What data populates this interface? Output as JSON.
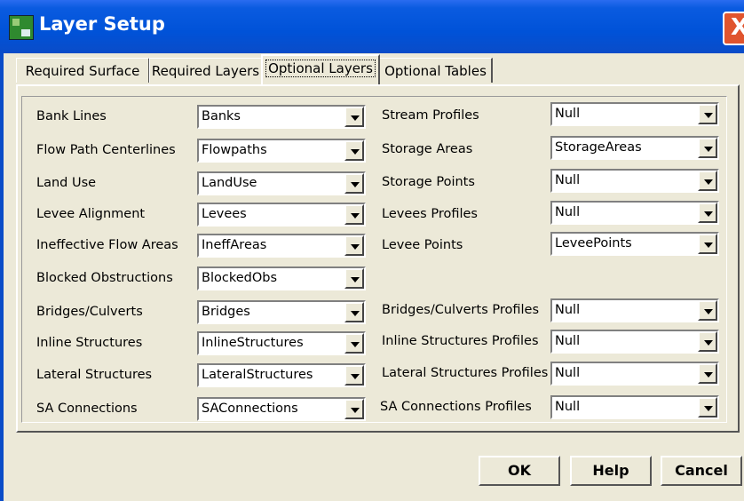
{
  "window": {
    "title": "Layer Setup",
    "close_label": "X"
  },
  "tabs": [
    {
      "label": "Required Surface"
    },
    {
      "label": "Required Layers"
    },
    {
      "label": "Optional Layers"
    },
    {
      "label": "Optional Tables"
    }
  ],
  "left_fields": [
    {
      "label": "Bank Lines",
      "value": "Banks"
    },
    {
      "label": "Flow Path Centerlines",
      "value": "Flowpaths"
    },
    {
      "label": "Land Use",
      "value": "LandUse"
    },
    {
      "label": "Levee Alignment",
      "value": "Levees"
    },
    {
      "label": "Ineffective Flow Areas",
      "value": "IneffAreas"
    },
    {
      "label": "Blocked Obstructions",
      "value": "BlockedObs"
    },
    {
      "label": "Bridges/Culverts",
      "value": "Bridges"
    },
    {
      "label": "Inline Structures",
      "value": "InlineStructures"
    },
    {
      "label": "Lateral Structures",
      "value": "LateralStructures"
    },
    {
      "label": "SA Connections",
      "value": "SAConnections"
    }
  ],
  "right_fields": [
    {
      "label": "Stream Profiles",
      "value": "Null"
    },
    {
      "label": "Storage Areas",
      "value": "StorageAreas"
    },
    {
      "label": "Storage Points",
      "value": "Null"
    },
    {
      "label": "Levees Profiles",
      "value": "Null"
    },
    {
      "label": "Levee Points",
      "value": "LeveePoints"
    },
    {
      "label": "Bridges/Culverts Profiles",
      "value": "Null"
    },
    {
      "label": "Inline Structures Profiles",
      "value": "Null"
    },
    {
      "label": "Lateral Structures Profiles",
      "value": "Null"
    },
    {
      "label": "SA Connections Profiles",
      "value": "Null"
    }
  ],
  "buttons": {
    "ok": "OK",
    "help": "Help",
    "cancel": "Cancel"
  }
}
